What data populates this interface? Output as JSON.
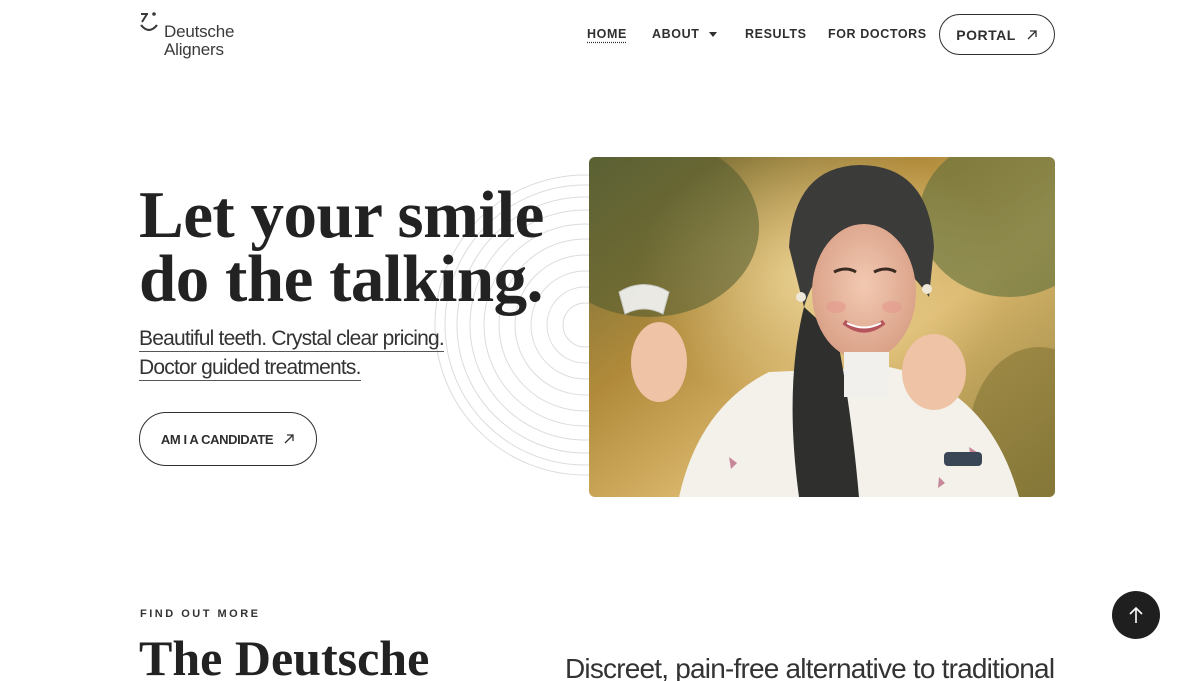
{
  "brand": {
    "name_line1": "Deutsche",
    "name_line2": "Aligners",
    "logo_icon": "smile-mark-icon"
  },
  "nav": {
    "items": [
      {
        "label": "HOME",
        "active": true
      },
      {
        "label": "ABOUT",
        "has_dropdown": true
      },
      {
        "label": "RESULTS"
      },
      {
        "label": "FOR DOCTORS"
      }
    ],
    "portal_label": "PORTAL"
  },
  "hero": {
    "title_line1": "Let your smile",
    "title_line2": "do the talking.",
    "subtitle_line1": "Beautiful teeth. Crystal clear pricing.",
    "subtitle_line2": "Doctor guided treatments.",
    "cta_label": "AM I A CANDIDATE"
  },
  "section": {
    "eyebrow": "FIND OUT MORE",
    "title": "The Deutsche",
    "lead": "Discreet, pain-free alternative to traditional"
  },
  "colors": {
    "text": "#2a2a2a",
    "button_border": "#2f2f2f",
    "scroll_top_bg": "#1f1f1f"
  },
  "icons": {
    "external": "arrow-up-right-icon",
    "dropdown": "caret-down-icon",
    "scroll_top": "arrow-up-icon"
  }
}
